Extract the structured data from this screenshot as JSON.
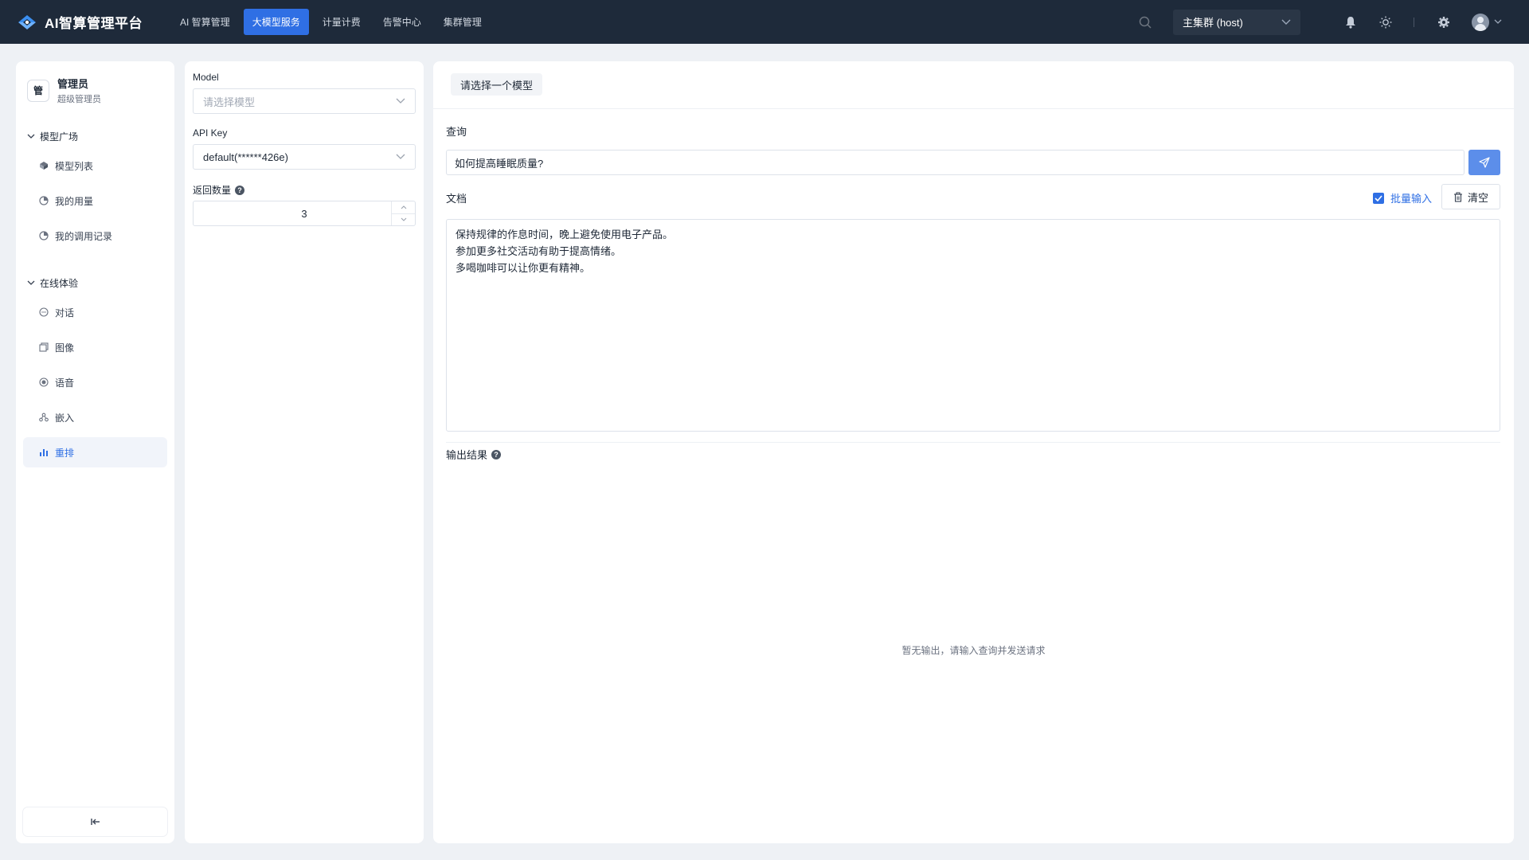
{
  "app": {
    "title": "AI智算管理平台",
    "brand_color": "#3b8ff0"
  },
  "nav": {
    "items": [
      {
        "label": "AI 智算管理",
        "active": false
      },
      {
        "label": "大模型服务",
        "active": true
      },
      {
        "label": "计量计费",
        "active": false
      },
      {
        "label": "告警中心",
        "active": false
      },
      {
        "label": "集群管理",
        "active": false
      }
    ]
  },
  "topbar": {
    "cluster": "主集群 (host)",
    "icons": [
      "search-icon",
      "bell-icon",
      "sun-icon",
      "gear-icon",
      "avatar"
    ]
  },
  "sidebar": {
    "profile": {
      "badge": "管",
      "name": "管理员",
      "role": "超级管理员"
    },
    "sections": [
      {
        "title": "模型广场",
        "items": [
          {
            "label": "模型列表",
            "icon": "cube-icon"
          },
          {
            "label": "我的用量",
            "icon": "chart-icon"
          },
          {
            "label": "我的调用记录",
            "icon": "record-icon"
          }
        ]
      },
      {
        "title": "在线体验",
        "items": [
          {
            "label": "对话",
            "icon": "chat-icon"
          },
          {
            "label": "图像",
            "icon": "image-icon"
          },
          {
            "label": "语音",
            "icon": "audio-icon"
          },
          {
            "label": "嵌入",
            "icon": "embed-icon"
          },
          {
            "label": "重排",
            "icon": "bar-chart-icon",
            "active": true
          }
        ]
      }
    ],
    "collapse_icon": "collapse-icon"
  },
  "config": {
    "model": {
      "label": "Model",
      "placeholder": "请选择模型",
      "value": ""
    },
    "api_key": {
      "label": "API Key",
      "value": "default(******426e)"
    },
    "top_n": {
      "label": "返回数量",
      "value": "3"
    }
  },
  "main": {
    "model_tab": "请选择一个模型",
    "query": {
      "label": "查询",
      "value": "如何提高睡眠质量?"
    },
    "documents": {
      "label": "文档",
      "batch_input_label": "批量输入",
      "batch_input_checked": true,
      "clear_label": "清空",
      "lines": [
        "保持规律的作息时间，晚上避免使用电子产品。",
        "参加更多社交活动有助于提高情绪。",
        "多喝咖啡可以让你更有精神。"
      ]
    },
    "output": {
      "label": "输出结果",
      "empty_text": "暂无输出，请输入查询并发送请求"
    }
  },
  "colors": {
    "topbar": "#1e2a3a",
    "accent": "#2f6fe4",
    "send_button": "#5c8eea"
  }
}
